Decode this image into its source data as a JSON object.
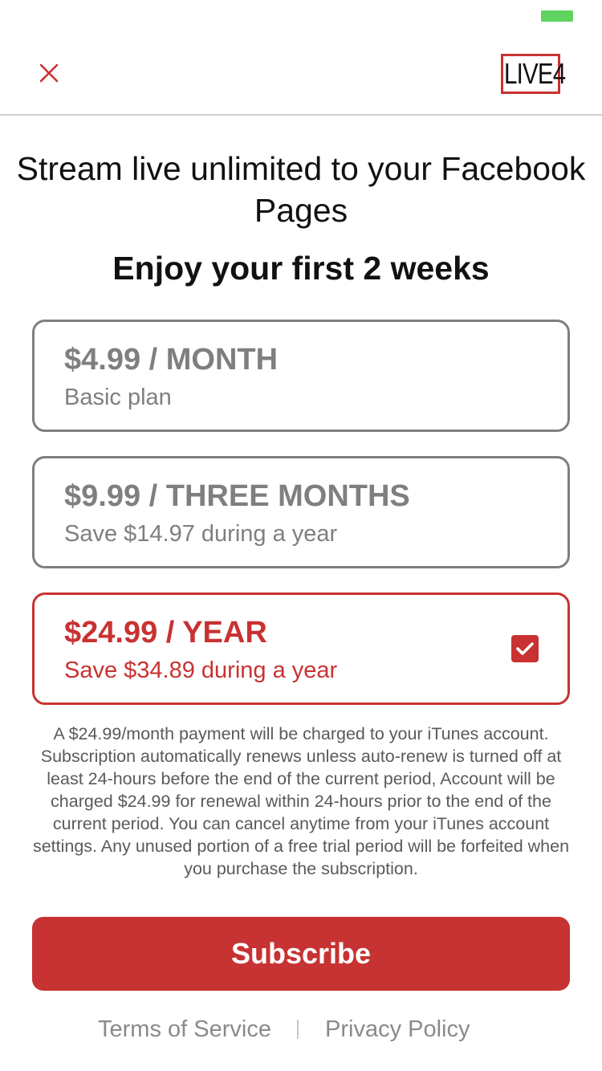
{
  "logo": {
    "text": "LIVE4"
  },
  "header": {
    "title": "Stream live unlimited to your Facebook Pages",
    "subtitle": "Enjoy your first 2 weeks"
  },
  "plans": [
    {
      "price": "$4.99 / MONTH",
      "description": "Basic plan",
      "selected": false
    },
    {
      "price": "$9.99 / THREE MONTHS",
      "description": "Save $14.97 during a year",
      "selected": false
    },
    {
      "price": "$24.99 / YEAR",
      "description": "Save $34.89 during a year",
      "selected": true
    }
  ],
  "legal_text": "A $24.99/month payment will be charged to your iTunes account. Subscription automatically renews unless auto-renew is turned off at least 24-hours before the end of the current period, Account will be charged $24.99 for renewal within 24-hours prior to the end of the current period. You can cancel anytime from your iTunes account settings. Any unused portion of a free trial period will be forfeited when you purchase the subscription.",
  "subscribe_label": "Subscribe",
  "footer": {
    "terms_label": "Terms of Service",
    "privacy_label": "Privacy Policy"
  },
  "icons": {
    "close": "close-icon",
    "check": "checkbox-checked-icon",
    "battery": "battery-icon"
  },
  "colors": {
    "accent": "#c93232",
    "muted": "#7f7f7f",
    "battery": "#5fd35f"
  }
}
